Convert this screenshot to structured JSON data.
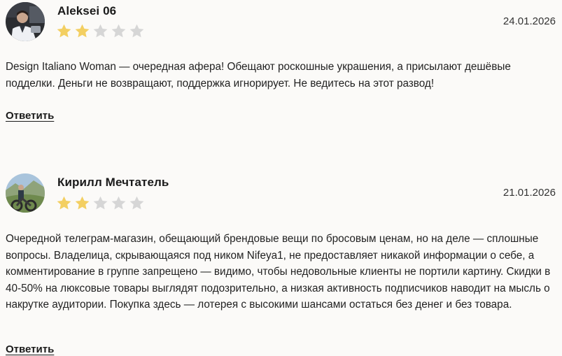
{
  "colors": {
    "star_filled": "#f3cf62",
    "star_empty": "#d6d6d6",
    "background": "#fbfaf8"
  },
  "reviews": [
    {
      "author": "Aleksei 06",
      "date": "24.01.2026",
      "rating": 2,
      "max_rating": 5,
      "text": "Design Italiano Woman — очередная афера! Обещают роскошные украшения, а присылают дешёвые подделки. Деньги не возвращают, поддержка игнорирует. Не ведитесь на этот развод!",
      "reply_label": "Ответить"
    },
    {
      "author": "Кирилл Мечтатель",
      "date": "21.01.2026",
      "rating": 2,
      "max_rating": 5,
      "text": "Очередной телеграм-магазин, обещающий брендовые вещи по бросовым ценам, но на деле — сплошные вопросы. Владелица, скрывающаяся под ником Nifeya1, не предоставляет никакой информации о себе, а комментирование в группе запрещено — видимо, чтобы недовольные клиенты не портили картину. Скидки в 40-50% на люксовые товары выглядят подозрительно, а низкая активность подписчиков наводит на мысль о накрутке аудитории. Покупка здесь — лотерея с высокими шансами остаться без денег и без товара.",
      "reply_label": "Ответить"
    }
  ]
}
